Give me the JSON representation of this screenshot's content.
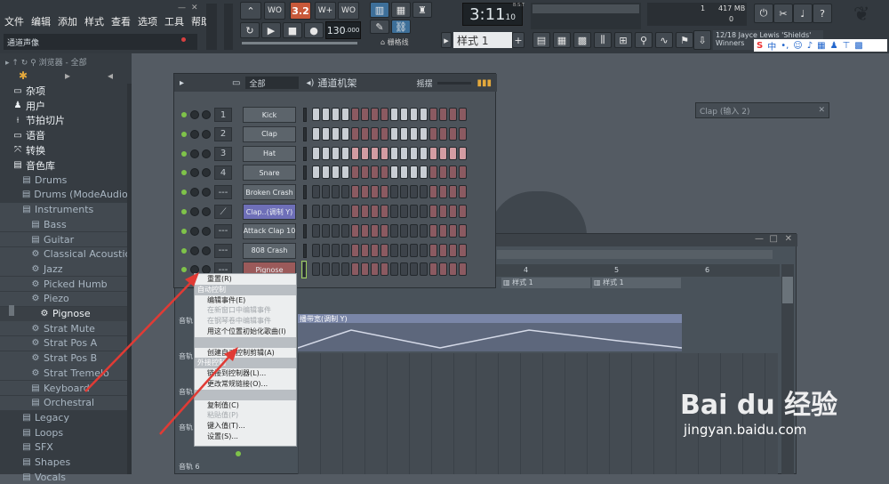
{
  "menu": [
    "文件",
    "编辑",
    "添加",
    "样式",
    "查看",
    "选项",
    "工具",
    "帮助"
  ],
  "hint": "通道声像",
  "transport": {
    "pattern_num": "3.2",
    "time": "3:11",
    "time_small": "10",
    "tempo": "130",
    "tempo_small": "000",
    "pattern_label": "样式 1",
    "grid_label": "栅格线",
    "ms_label": "B:S:T"
  },
  "cpu": {
    "value": "1",
    "mem": "417 MB",
    "poly": "0"
  },
  "song": {
    "line1": "12/18  Jayce Lewis 'Shields'",
    "line2": "Winners"
  },
  "browser": {
    "header": "浏览器 - 全部",
    "items": [
      {
        "label": "杂项",
        "icon": "▭",
        "indent": 0,
        "bright": true
      },
      {
        "label": "用户",
        "icon": "♟",
        "indent": 0,
        "bright": true
      },
      {
        "label": "节拍切片",
        "icon": "⟊",
        "indent": 0,
        "bright": true
      },
      {
        "label": "语音",
        "icon": "▭",
        "indent": 0,
        "bright": true
      },
      {
        "label": "转换",
        "icon": "⤧",
        "indent": 0,
        "bright": true
      },
      {
        "label": "音色库",
        "icon": "▤",
        "indent": 0,
        "bright": true
      },
      {
        "label": "Drums",
        "icon": "▤",
        "indent": 1
      },
      {
        "label": "Drums (ModeAudio)",
        "icon": "▤",
        "indent": 1
      },
      {
        "label": "Instruments",
        "icon": "▤",
        "indent": 1
      },
      {
        "label": "Bass",
        "icon": "▤",
        "indent": 2
      },
      {
        "label": "Guitar",
        "icon": "▤",
        "indent": 2
      },
      {
        "label": "Classical Acoustic",
        "icon": "⚙",
        "indent": 2
      },
      {
        "label": "Jazz",
        "icon": "⚙",
        "indent": 2
      },
      {
        "label": "Picked Humb",
        "icon": "⚙",
        "indent": 2
      },
      {
        "label": "Piezo",
        "icon": "⚙",
        "indent": 2
      },
      {
        "label": "Pignose",
        "icon": "⚙",
        "indent": 3,
        "bright": true
      },
      {
        "label": "Strat Mute",
        "icon": "⚙",
        "indent": 2
      },
      {
        "label": "Strat Pos A",
        "icon": "⚙",
        "indent": 2
      },
      {
        "label": "Strat Pos B",
        "icon": "⚙",
        "indent": 2
      },
      {
        "label": "Strat Tremelo",
        "icon": "⚙",
        "indent": 2
      },
      {
        "label": "Keyboard",
        "icon": "▤",
        "indent": 2
      },
      {
        "label": "Orchestral",
        "icon": "▤",
        "indent": 2
      },
      {
        "label": "Legacy",
        "icon": "▤",
        "indent": 1
      },
      {
        "label": "Loops",
        "icon": "▤",
        "indent": 1
      },
      {
        "label": "SFX",
        "icon": "▤",
        "indent": 1
      },
      {
        "label": "Shapes",
        "icon": "▤",
        "indent": 1
      },
      {
        "label": "Vocals",
        "icon": "▤",
        "indent": 1
      }
    ]
  },
  "rack": {
    "title": "通道机架",
    "filter": "全部",
    "swing": "摇摆",
    "channels": [
      {
        "num": "1",
        "name": "Kick",
        "steps": "wwwwrrrrwwwwrrrr"
      },
      {
        "num": "2",
        "name": "Clap",
        "steps": "wwwwrrrrwwwwrrrr"
      },
      {
        "num": "3",
        "name": "Hat",
        "steps": "wwwwRRRRwwwwRRRR"
      },
      {
        "num": "4",
        "name": "Snare",
        "steps": "wwwwrrrrwwwwrrrr"
      },
      {
        "num": "---",
        "name": "Broken Crash",
        "steps": "nnnnrrrrnnnnrrrr"
      },
      {
        "num": "",
        "name": "Clap..(调制 Y)",
        "steps": "nnnnrrrrnnnnrrrr",
        "sel": true
      },
      {
        "num": "---",
        "name": "Attack Clap 10",
        "steps": "nnnnrrrrnnnnrrrr"
      },
      {
        "num": "---",
        "name": "808 Crash",
        "steps": "nnnnrrrrnnnnrrrr"
      },
      {
        "num": "---",
        "name": "Pignose",
        "steps": "nnnnrrrrnnnnrrrr",
        "red": true
      }
    ]
  },
  "context_menu": [
    {
      "label": "重置(R)",
      "type": "item"
    },
    {
      "label": "自动控制",
      "type": "sec"
    },
    {
      "label": "编辑事件(E)",
      "type": "item"
    },
    {
      "label": "在新窗口中编辑事件",
      "type": "dis"
    },
    {
      "label": "在钢琴卷中编辑事件",
      "type": "dis"
    },
    {
      "label": "用这个位置初始化歌曲(I)",
      "type": "item"
    },
    {
      "label": "",
      "type": "sec"
    },
    {
      "label": "创建自动控制剪辑(A)",
      "type": "item"
    },
    {
      "label": "外接控制",
      "type": "sec"
    },
    {
      "label": "链接到控制器(L)...",
      "type": "item"
    },
    {
      "label": "更改常规链接(O)...",
      "type": "item"
    },
    {
      "label": "",
      "type": "sec"
    },
    {
      "label": "复制值(C)",
      "type": "item"
    },
    {
      "label": "粘贴值(P)",
      "type": "dis"
    },
    {
      "label": "键入值(T)...",
      "type": "item"
    },
    {
      "label": "设置(S)...",
      "type": "item"
    }
  ],
  "playlist": {
    "bars": [
      "4",
      "5",
      "6"
    ],
    "pattern": "样式 1",
    "clip": "播带宽(调制 Y)",
    "track_labels": [
      "音轨",
      "音轨",
      "音轨",
      "音轨",
      "音轨 6"
    ]
  },
  "small_window": {
    "title": "Clap (输入 2)"
  },
  "ime": "中",
  "watermark": {
    "brand": "Bai du 经验",
    "url": "jingyan.baidu.com"
  }
}
